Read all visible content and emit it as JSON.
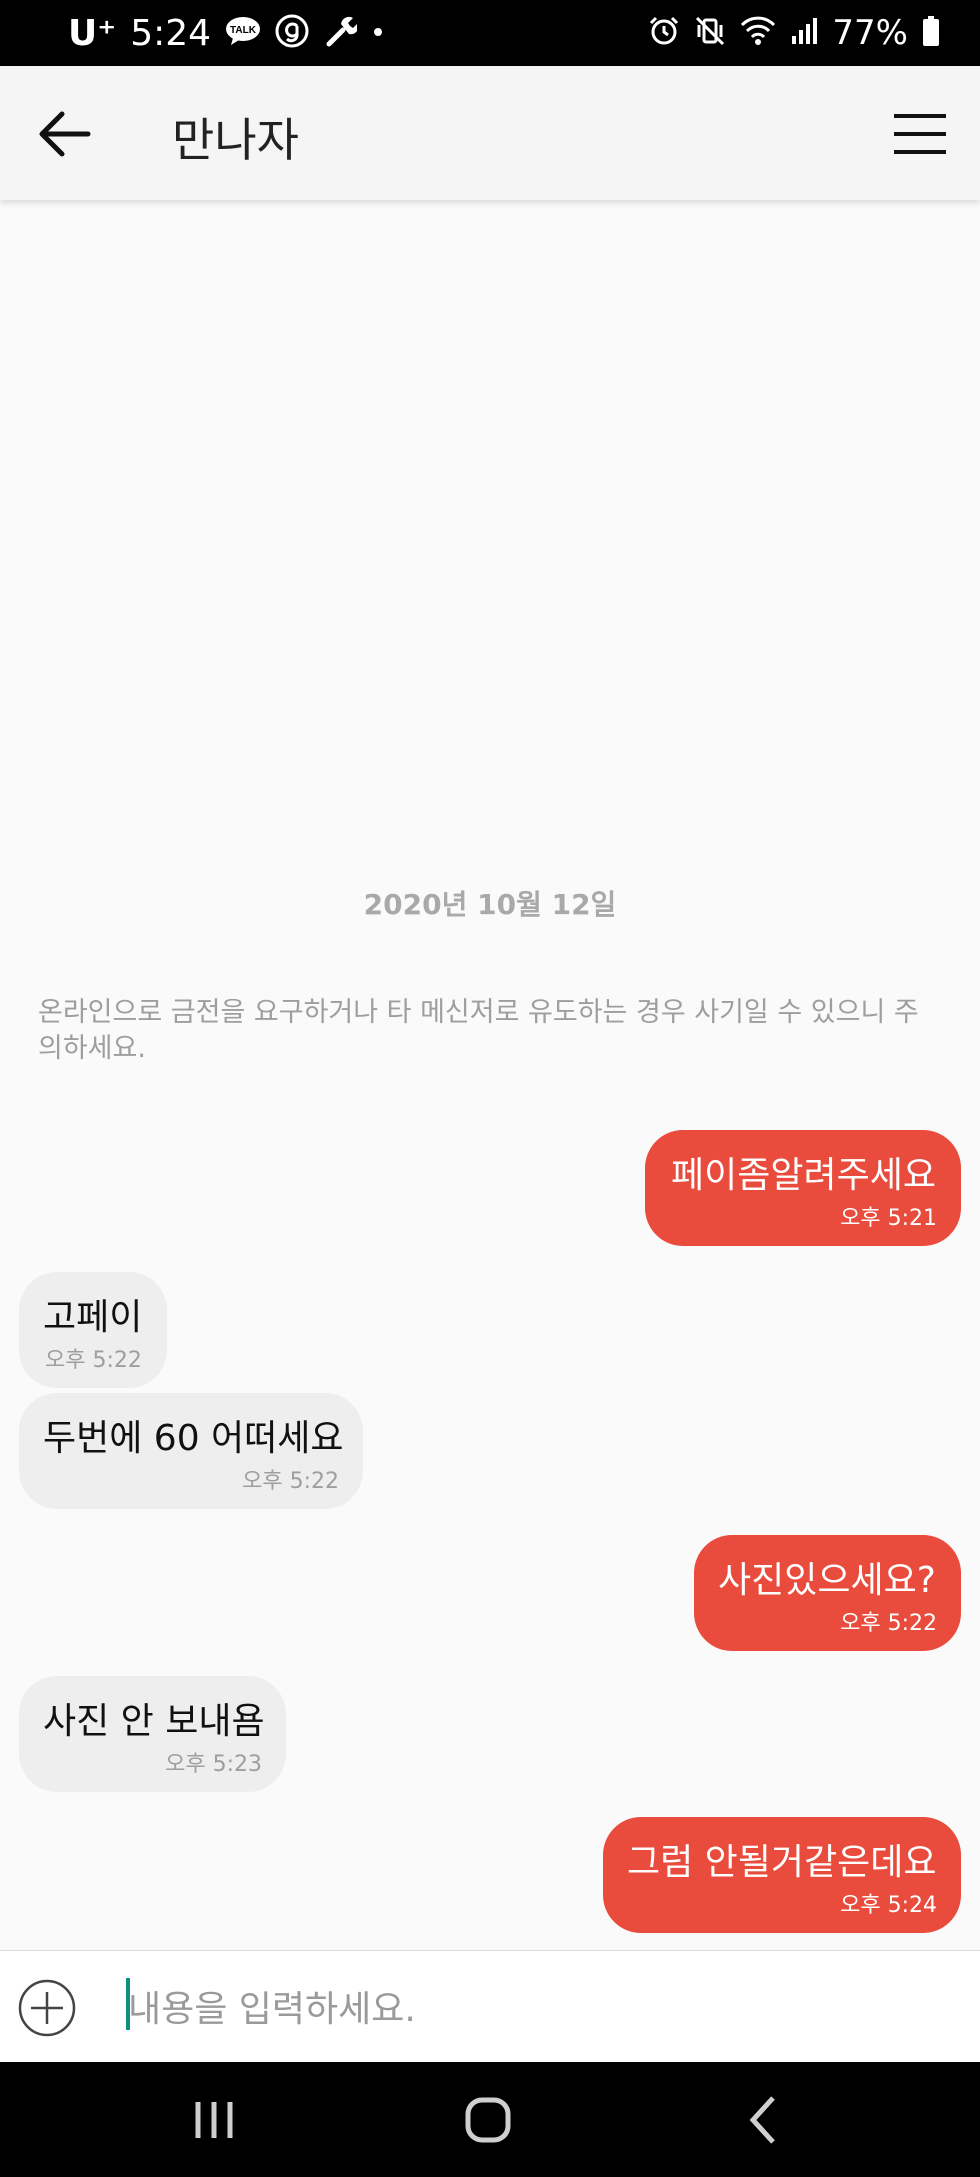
{
  "status_bar": {
    "carrier": "U⁺",
    "time": "5:24",
    "battery": "77%",
    "left_icons": [
      "talk-icon",
      "g-icon",
      "wrench-icon",
      "dot-icon"
    ],
    "right_icons": [
      "alarm-icon",
      "vibrate-icon",
      "wifi-icon",
      "signal-icon",
      "battery-icon"
    ],
    "talk_label": "TALK"
  },
  "app_bar": {
    "title": "만나자",
    "back_icon": "arrow-left-icon",
    "menu_icon": "hamburger-menu-icon"
  },
  "chat": {
    "date": "2020년 10월 12일",
    "warning": "온라인으로 금전을 요구하거나 타 메신저로 유도하는 경우 사기일 수 있으니 주의하세요.",
    "messages": [
      {
        "sender": "me",
        "text": "페이좀알려주세요",
        "time": "오후 5:21"
      },
      {
        "sender": "them",
        "text": "고페이",
        "time": "오후 5:22"
      },
      {
        "sender": "them",
        "text": "두번에 60 어떠세요",
        "time": "오후 5:22"
      },
      {
        "sender": "me",
        "text": "사진있으세요?",
        "time": "오후 5:22"
      },
      {
        "sender": "them",
        "text": "사진 안 보내욤",
        "time": "오후 5:23"
      },
      {
        "sender": "me",
        "text": "그럼 안될거같은데요",
        "time": "오후 5:24"
      }
    ]
  },
  "input": {
    "placeholder": "내용을 입력하세요.",
    "value": ""
  },
  "colors": {
    "my_bubble": "#e94b3c",
    "their_bubble": "#eeeeee",
    "caret": "#0f8f7f"
  }
}
